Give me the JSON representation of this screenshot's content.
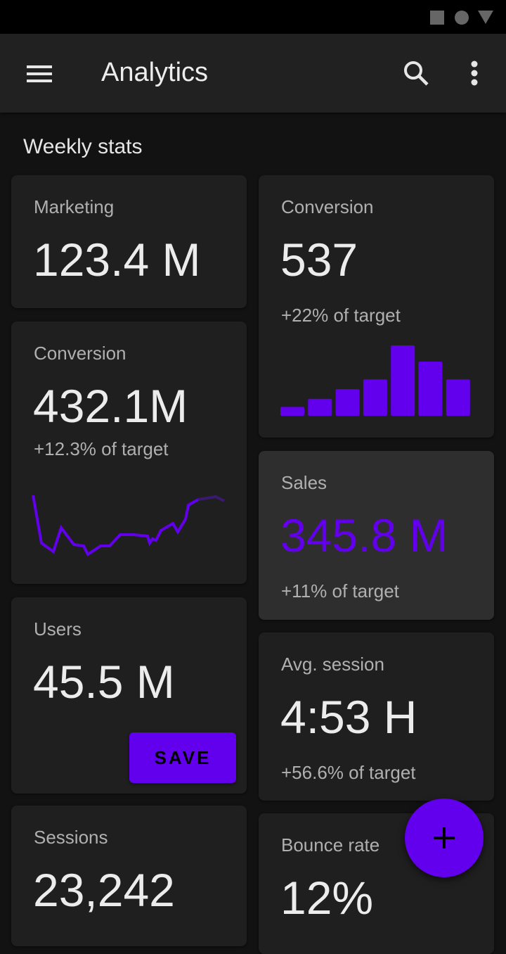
{
  "status_bar": {
    "icons": [
      "square-icon",
      "circle-icon",
      "triangle-icon"
    ]
  },
  "app_bar": {
    "title": "Analytics",
    "icons": {
      "menu": "menu-icon",
      "search": "search-icon",
      "more": "more-vert-icon"
    }
  },
  "section_title": "Weekly stats",
  "accent_color": "#6200ee",
  "cards": {
    "marketing": {
      "label": "Marketing",
      "value": "123.4 M"
    },
    "conversion_bar": {
      "label": "Conversion",
      "value": "537",
      "sub": "+22% of target",
      "chart_values": [
        1.1,
        2.1,
        3.3,
        4.5,
        8.7,
        6.7,
        4.5
      ]
    },
    "conversion_line": {
      "label": "Conversion",
      "value": "432.1M",
      "sub": "+12.3% of target",
      "chart_values": [
        89,
        55,
        49,
        66,
        54,
        53,
        47,
        53,
        53,
        61,
        61,
        60,
        55,
        58,
        57,
        64,
        69,
        63,
        72,
        82,
        86,
        88,
        85
      ]
    },
    "sales": {
      "label": "Sales",
      "value": "345.8 M",
      "sub": "+11% of target"
    },
    "users": {
      "label": "Users",
      "value": "45.5 M",
      "button": "SAVE"
    },
    "avg_session": {
      "label": "Avg. session",
      "value": "4:53 H",
      "sub": "+56.6% of target"
    },
    "sessions": {
      "label": "Sessions",
      "value": "23,242"
    },
    "bounce_rate": {
      "label": "Bounce rate",
      "value": "12%"
    }
  },
  "fab": {
    "icon": "add-icon"
  }
}
